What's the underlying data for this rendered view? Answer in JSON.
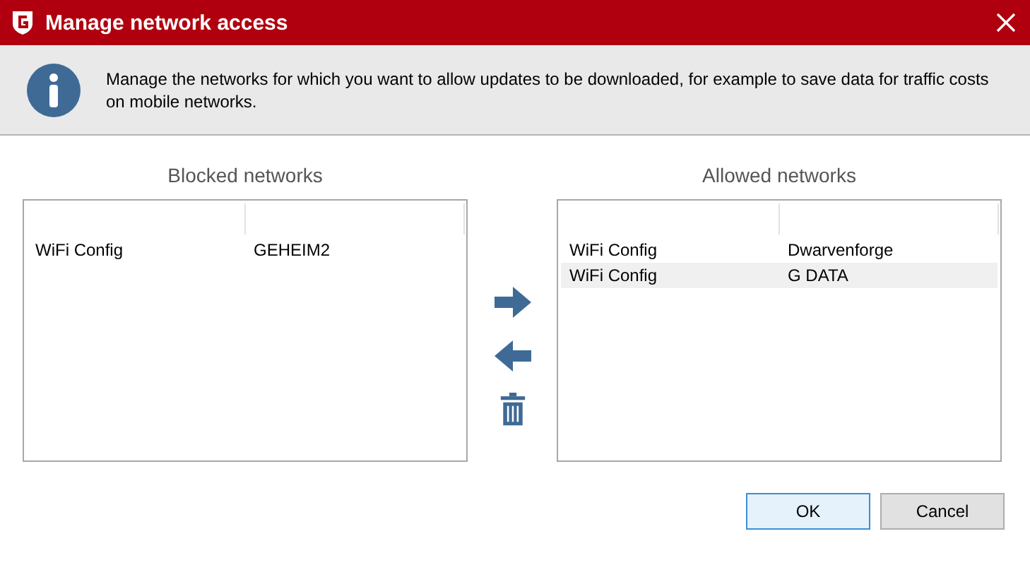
{
  "window": {
    "title": "Manage network access"
  },
  "info": {
    "message": "Manage the networks for which you want to allow updates to be downloaded, for example to save data for traffic costs on mobile networks."
  },
  "blocked": {
    "title": "Blocked networks",
    "rows": [
      {
        "cells": [
          "WiFi Config",
          "GEHEIM2"
        ],
        "selected": false
      }
    ]
  },
  "allowed": {
    "title": "Allowed networks",
    "rows": [
      {
        "cells": [
          "WiFi Config",
          "Dwarvenforge"
        ],
        "selected": false
      },
      {
        "cells": [
          "WiFi Config",
          "G DATA"
        ],
        "selected": true
      }
    ]
  },
  "buttons": [
    {
      "label": "OK",
      "default": true
    },
    {
      "label": "Cancel",
      "default": false
    }
  ]
}
